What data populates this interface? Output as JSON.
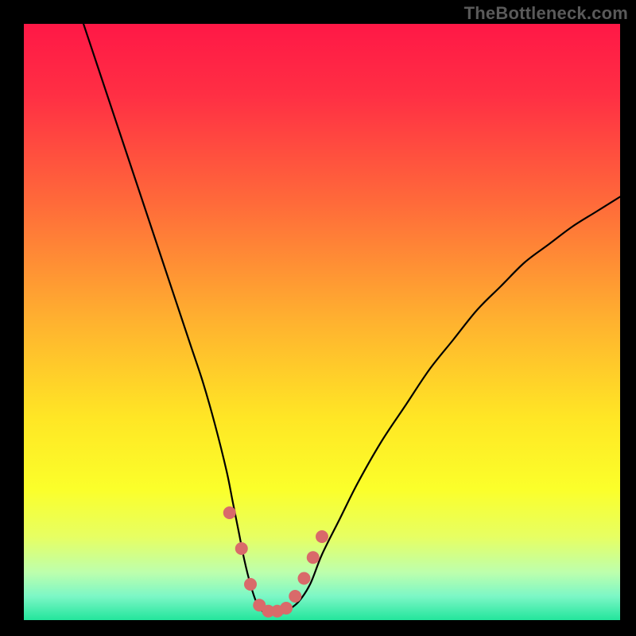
{
  "watermark": "TheBottleneck.com",
  "chart_data": {
    "type": "line",
    "title": "",
    "xlabel": "",
    "ylabel": "",
    "xlim": [
      0,
      100
    ],
    "ylim": [
      0,
      100
    ],
    "background_gradient_stops": [
      {
        "offset": 0.0,
        "color": "#ff1846"
      },
      {
        "offset": 0.12,
        "color": "#ff2f44"
      },
      {
        "offset": 0.3,
        "color": "#ff6a3a"
      },
      {
        "offset": 0.5,
        "color": "#ffb22f"
      },
      {
        "offset": 0.66,
        "color": "#ffe625"
      },
      {
        "offset": 0.78,
        "color": "#fbff2a"
      },
      {
        "offset": 0.86,
        "color": "#e7ff62"
      },
      {
        "offset": 0.92,
        "color": "#bdffad"
      },
      {
        "offset": 0.96,
        "color": "#7cf7c6"
      },
      {
        "offset": 1.0,
        "color": "#23e59c"
      }
    ],
    "series": [
      {
        "name": "bottleneck-curve",
        "color": "#000000",
        "stroke_width": 2.2,
        "x": [
          10,
          12,
          14,
          16,
          18,
          20,
          22,
          24,
          26,
          28,
          30,
          32,
          34,
          35,
          36,
          37,
          38,
          39,
          40,
          41,
          42,
          43,
          44,
          46,
          48,
          50,
          53,
          56,
          60,
          64,
          68,
          72,
          76,
          80,
          84,
          88,
          92,
          96,
          100
        ],
        "y": [
          100,
          94,
          88,
          82,
          76,
          70,
          64,
          58,
          52,
          46,
          40,
          33,
          25,
          20,
          15,
          10,
          6,
          3,
          1.5,
          1,
          1,
          1,
          1.5,
          3,
          6,
          11,
          17,
          23,
          30,
          36,
          42,
          47,
          52,
          56,
          60,
          63,
          66,
          68.5,
          71
        ]
      },
      {
        "name": "optimal-markers",
        "color": "#d96a6a",
        "marker_radius": 8,
        "x": [
          34.5,
          36.5,
          38.0,
          39.5,
          41.0,
          42.5,
          44.0,
          45.5,
          47.0,
          48.5,
          50.0
        ],
        "y": [
          18.0,
          12.0,
          6.0,
          2.5,
          1.5,
          1.5,
          2.0,
          4.0,
          7.0,
          10.5,
          14.0
        ]
      }
    ],
    "annotations": []
  }
}
